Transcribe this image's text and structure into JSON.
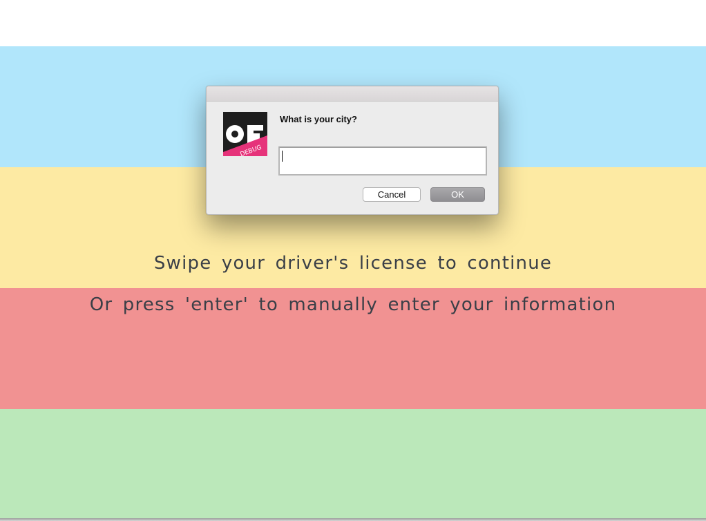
{
  "colors": {
    "band_blue": "#b1e6fb",
    "band_yellow": "#fdeaa3",
    "band_red": "#f19292",
    "band_green": "#bbe8ba",
    "prompt_text": "#3a3f47"
  },
  "prompts": {
    "swipe": "Swipe your driver's license to continue",
    "enter": "Or press 'enter' to manually enter your information"
  },
  "dialog": {
    "icon": "app-logo-icon",
    "icon_badge": "DEBUG",
    "message": "What is your city?",
    "input_value": "",
    "cancel_label": "Cancel",
    "ok_label": "OK"
  }
}
